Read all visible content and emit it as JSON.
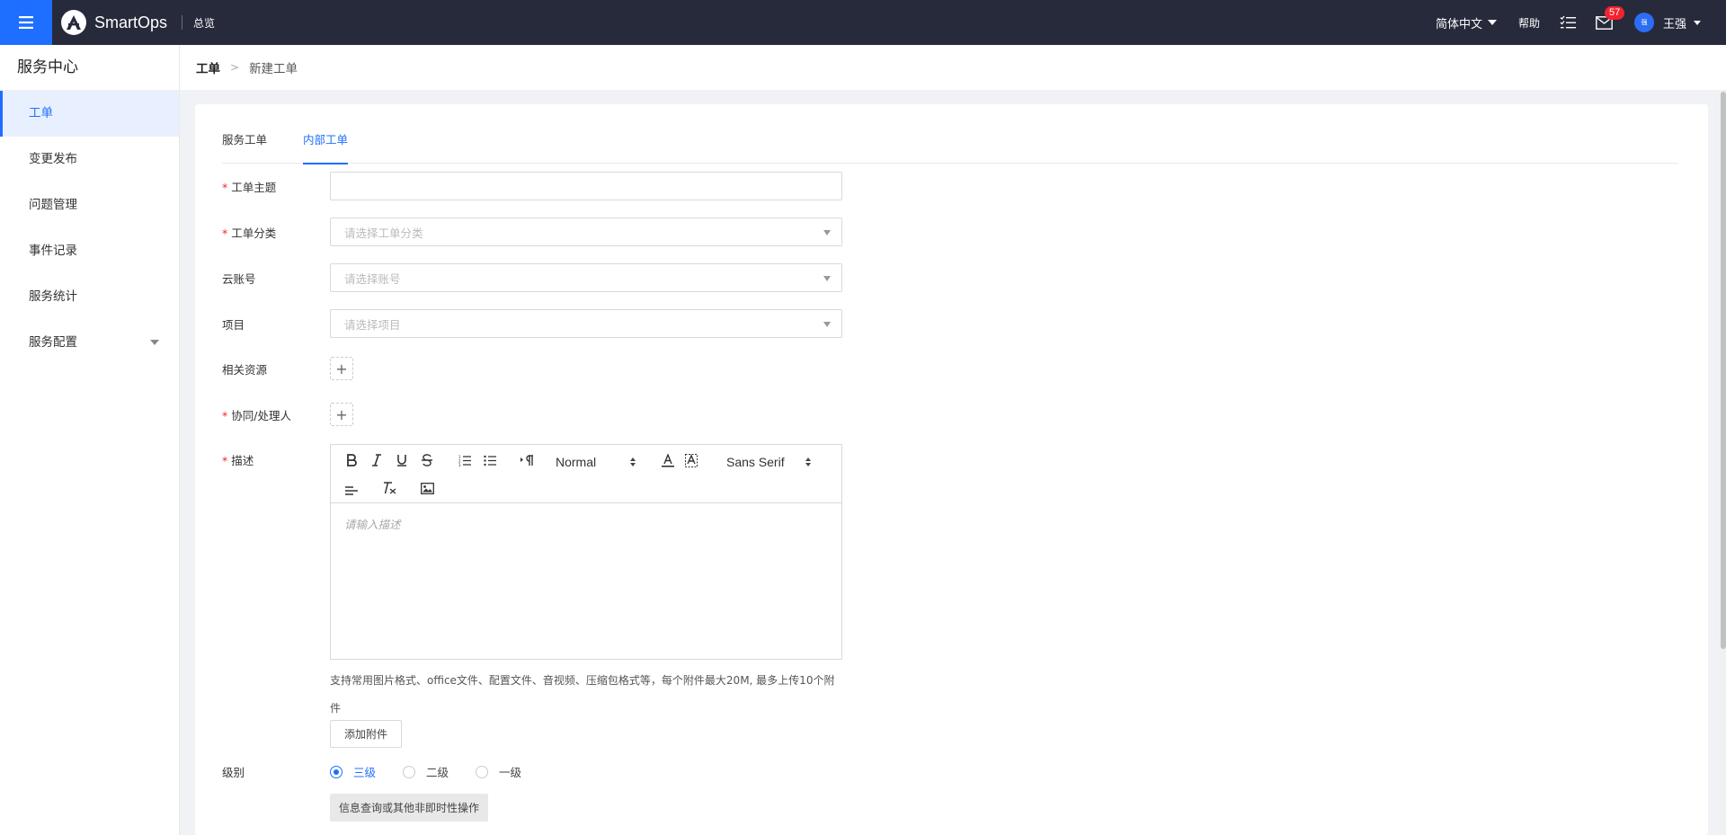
{
  "topbar": {
    "brand": "SmartOps",
    "overview": "总览",
    "language": "简体中文",
    "help": "帮助",
    "message_count": "57",
    "avatar_initial": "强",
    "user_name": "王强"
  },
  "sidebar": {
    "title": "服务中心",
    "items": [
      {
        "label": "工单",
        "active": true
      },
      {
        "label": "变更发布"
      },
      {
        "label": "问题管理"
      },
      {
        "label": "事件记录"
      },
      {
        "label": "服务统计"
      },
      {
        "label": "服务配置",
        "has_submenu": true
      }
    ]
  },
  "breadcrumb": {
    "root": "工单",
    "separator": ">",
    "current": "新建工单"
  },
  "tabs": [
    {
      "label": "服务工单"
    },
    {
      "label": "内部工单",
      "active": true
    }
  ],
  "form": {
    "subject": {
      "label": "工单主题",
      "required": "*",
      "value": ""
    },
    "category": {
      "label": "工单分类",
      "required": "*",
      "placeholder": "请选择工单分类"
    },
    "cloud_account": {
      "label": "云账号",
      "placeholder": "请选择账号"
    },
    "project": {
      "label": "项目",
      "placeholder": "请选择项目"
    },
    "related_resources": {
      "label": "相关资源",
      "add": "+"
    },
    "assignees": {
      "label": "协同/处理人",
      "required": "*",
      "add": "+"
    },
    "description": {
      "label": "描述",
      "required": "*",
      "placeholder": "请输入描述",
      "header_select": "Normal",
      "font_select": "Sans Serif"
    },
    "attachment_hint": "支持常用图片格式、office文件、配置文件、音视频、压缩包格式等，每个附件最大20M, 最多上传10个附件",
    "attachment_button": "添加附件",
    "level": {
      "label": "级别",
      "options": [
        {
          "label": "三级",
          "checked": true
        },
        {
          "label": "二级"
        },
        {
          "label": "一级"
        }
      ],
      "note": "信息查询或其他非即时性操作"
    }
  },
  "colors": {
    "accent": "#1e6fff",
    "topbar": "#262a3b",
    "required": "#f5222d",
    "badge": "#f5222d"
  }
}
